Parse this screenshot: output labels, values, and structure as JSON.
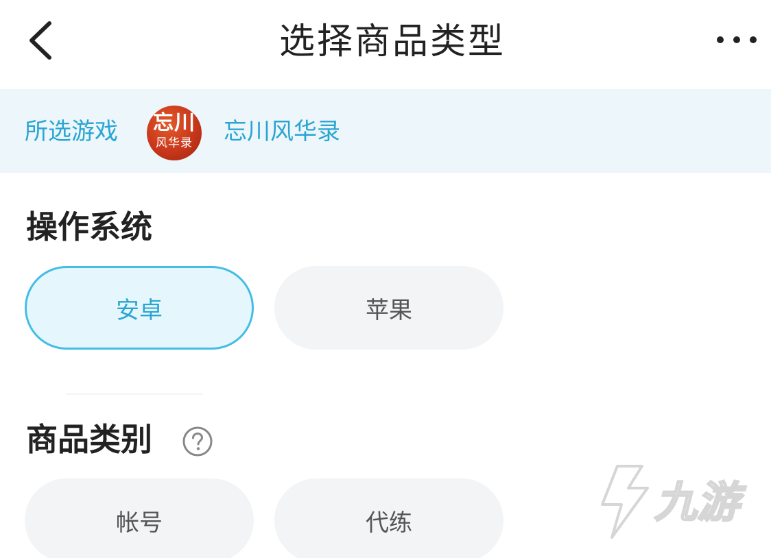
{
  "header": {
    "title": "选择商品类型",
    "back_icon": "chevron-left-icon",
    "more_icon": "more-horizontal-icon"
  },
  "game": {
    "label": "所选游戏",
    "logo_text_top": "忘川",
    "logo_text_bottom": "风华录",
    "name": "忘川风华录"
  },
  "sections": {
    "os": {
      "title": "操作系统",
      "options": [
        "安卓",
        "苹果"
      ],
      "selected": "安卓"
    },
    "category": {
      "title": "商品类别",
      "help_icon": "question-circle-icon",
      "options": [
        "帐号",
        "代练"
      ]
    }
  },
  "watermark": {
    "text": "九游"
  },
  "colors": {
    "accent": "#2aa5d3",
    "accent_border": "#44bde6",
    "banner_bg": "#ecf6fb",
    "chip_bg": "#f3f4f6",
    "selected_chip_bg": "#e5f6fc",
    "logo_red": "#c8371a"
  }
}
